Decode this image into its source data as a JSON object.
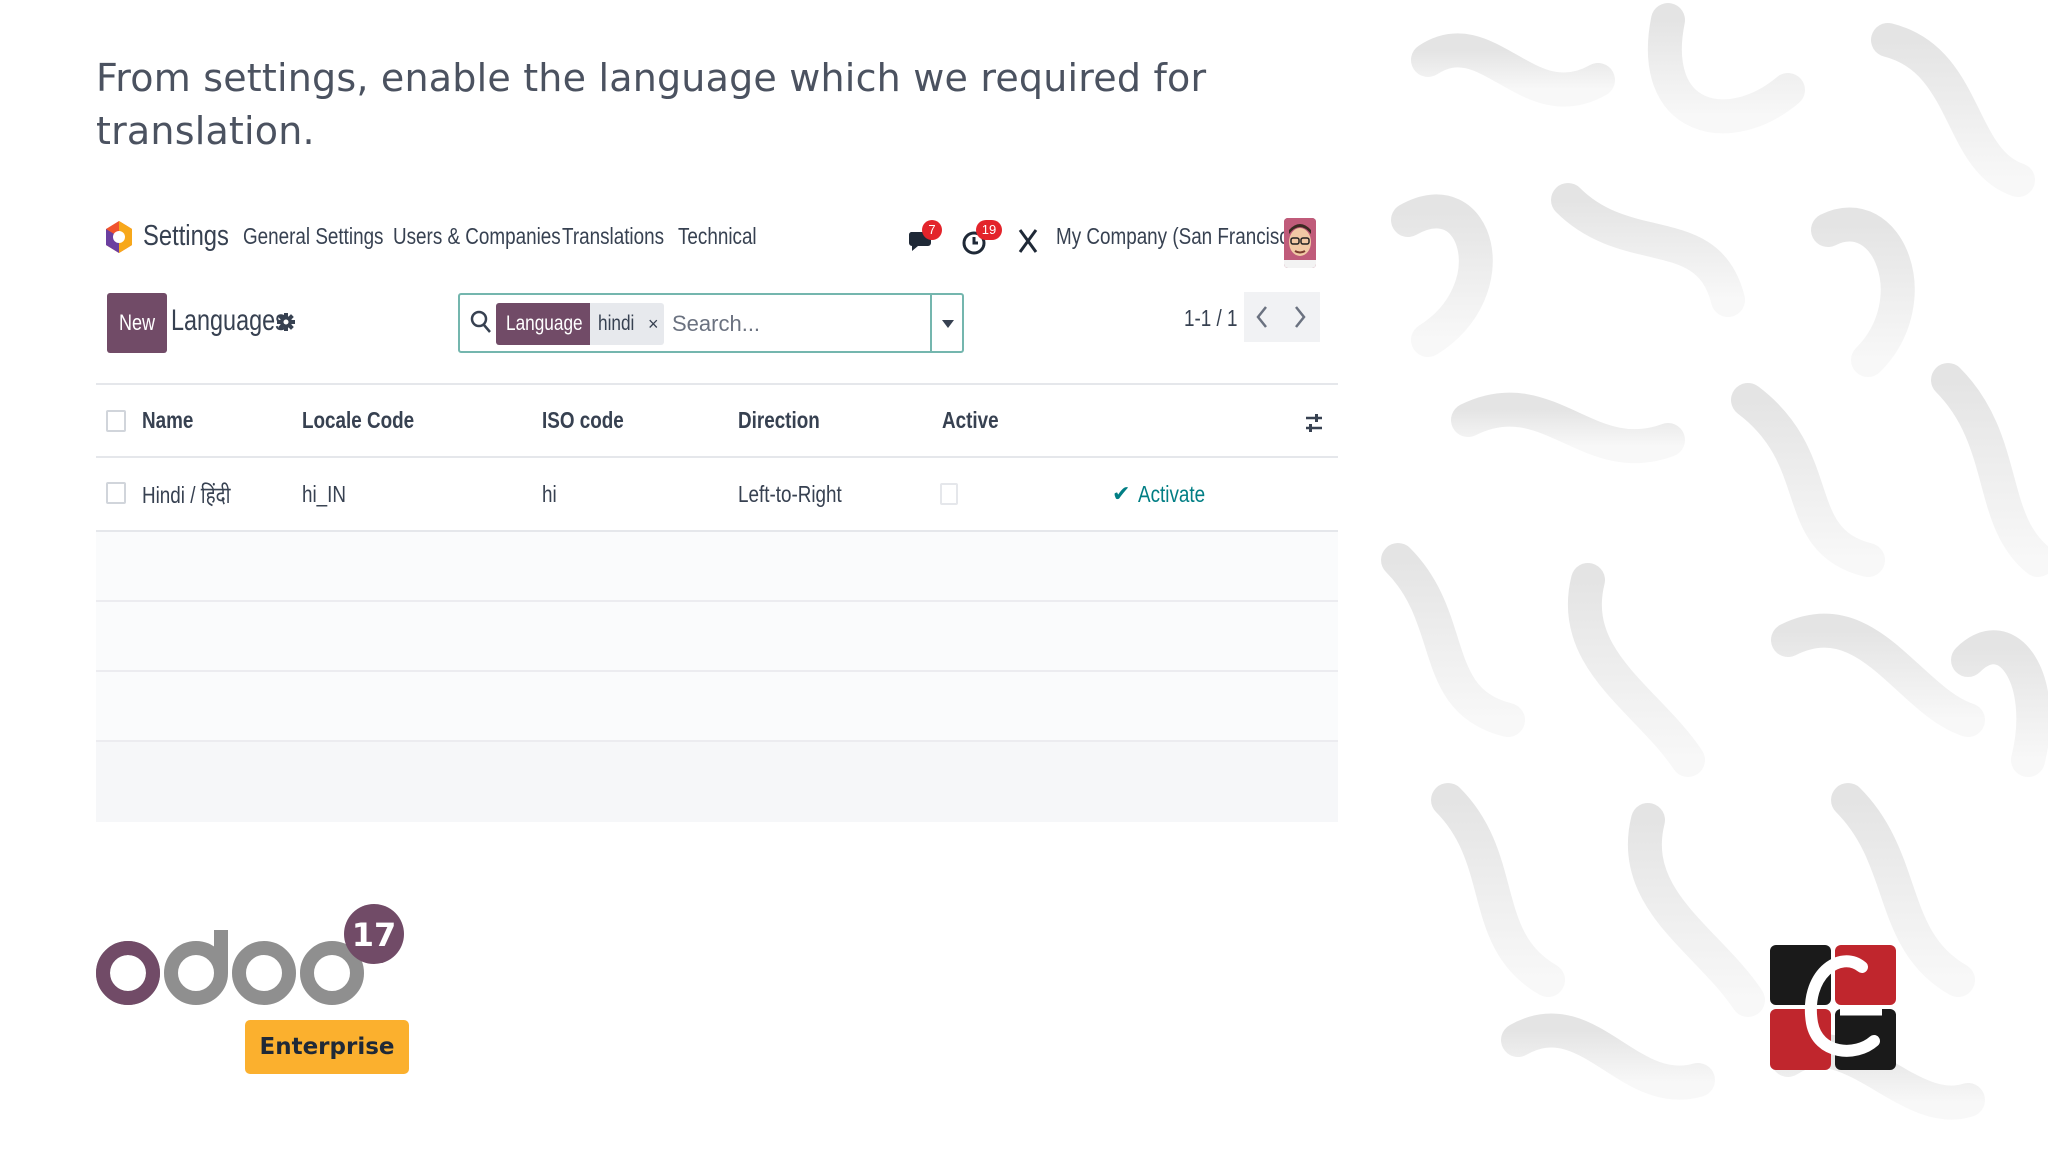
{
  "headline": "From settings, enable the language which we required for translation.",
  "navbar": {
    "app_name": "Settings",
    "menu": [
      "General Settings",
      "Users & Companies",
      "Translations",
      "Technical"
    ],
    "messages_count": "7",
    "activities_count": "19",
    "company": "My Company (San Francisco)"
  },
  "control_panel": {
    "new_label": "New",
    "title": "Languages",
    "search": {
      "facet_name": "Language",
      "facet_value": "hindi",
      "placeholder": "Search..."
    },
    "pager": "1-1 / 1"
  },
  "table": {
    "columns": [
      "Name",
      "Locale Code",
      "ISO code",
      "Direction",
      "Active"
    ],
    "rows": [
      {
        "name": "Hindi / हिंदी",
        "locale": "hi_IN",
        "iso": "hi",
        "direction": "Left-to-Right",
        "action": "Activate"
      }
    ]
  },
  "branding": {
    "version": "17",
    "edition": "Enterprise"
  },
  "colors": {
    "primary": "#714b67",
    "accent": "#017e84",
    "badge": "#e3242b",
    "enterprise": "#fbb02e"
  }
}
